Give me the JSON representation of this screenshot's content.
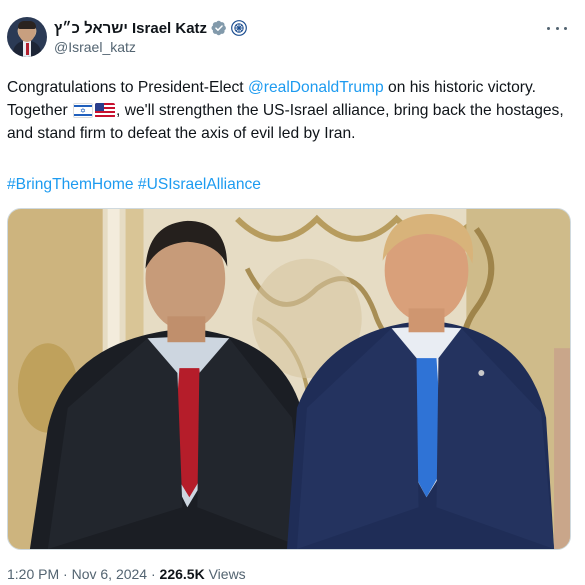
{
  "author": {
    "display_name": "ישראל כ״ץ Israel Katz",
    "handle": "@Israel_katz",
    "verified_icon": "verified-badge-icon",
    "affiliation_icon": "government-emblem-icon"
  },
  "tweet": {
    "text_before_mention": "Congratulations to President-Elect ",
    "mention": "@realDonaldTrump",
    "text_after_mention": " on his historic victory. Together ",
    "flags": [
      "israel-flag-icon",
      "us-flag-icon"
    ],
    "text_after_flags": ", we'll strengthen the US-Israel alliance, bring back the hostages, and stand firm to defeat the axis of evil led by Iran.",
    "hashtags": [
      "#BringThemHome",
      "#USIsraelAlliance"
    ]
  },
  "meta": {
    "time": "1:20 PM",
    "separator": " · ",
    "date": "Nov 6, 2024",
    "views_count": "226.5K",
    "views_label": " Views"
  },
  "colors": {
    "link": "#1d9bf0",
    "verified": "#829aab",
    "text": "#0f1419",
    "muted": "#536471"
  }
}
